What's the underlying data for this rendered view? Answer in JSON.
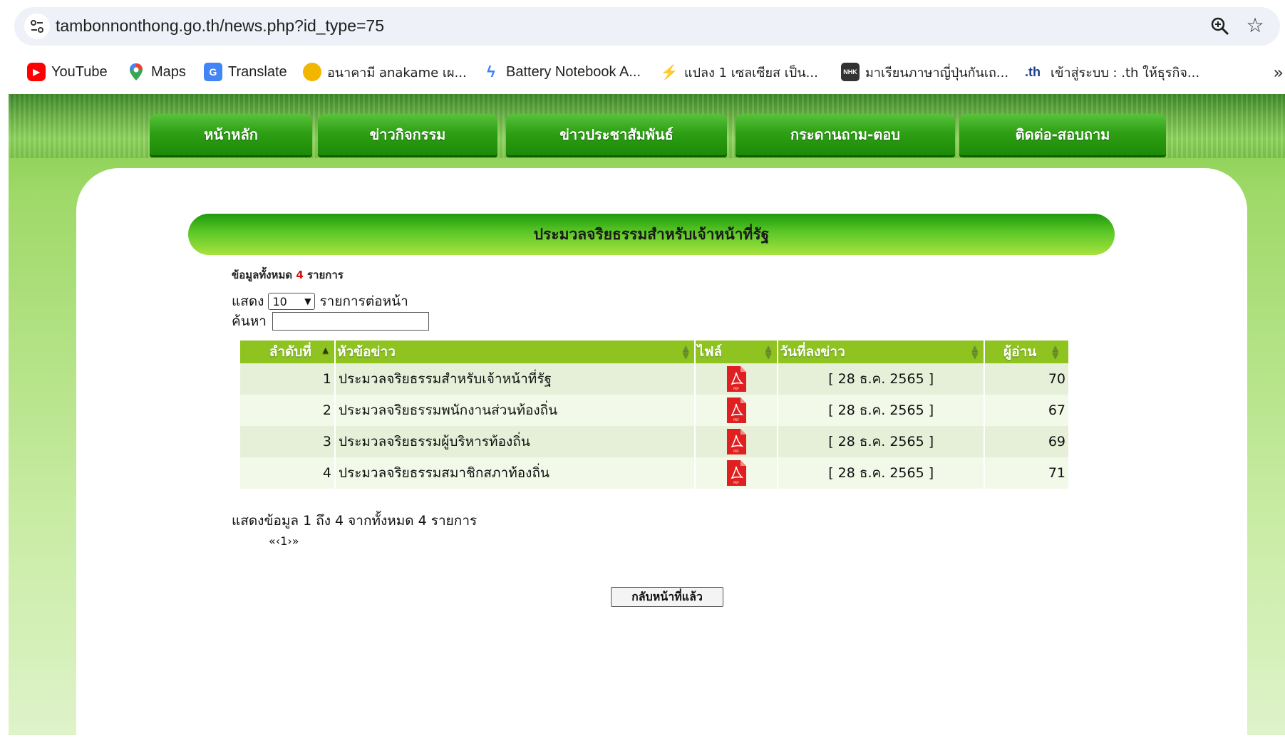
{
  "browser": {
    "url": "tambonnonthong.go.th/news.php?id_type=75"
  },
  "bookmarks": [
    {
      "label": "YouTube",
      "icon": "youtube-icon"
    },
    {
      "label": "Maps",
      "icon": "maps-icon"
    },
    {
      "label": "Translate",
      "icon": "translate-icon"
    },
    {
      "label": "อนาคามี anakame เผ...",
      "icon": "circle-icon"
    },
    {
      "label": "Battery Notebook A...",
      "icon": "bolt-icon"
    },
    {
      "label": "แปลง 1 เซลเซียส เป็น...",
      "icon": "convert-icon"
    },
    {
      "label": "มาเรียนภาษาญี่ปุ่นกันเถ...",
      "icon": "nhk-icon"
    },
    {
      "label": "เข้าสู่ระบบ : .th ให้ธุรกิจ...",
      "icon": "th-icon"
    }
  ],
  "nav": [
    "หน้าหลัก",
    "ข่าวกิจกรรม",
    "ข่าวประชาสัมพันธ์",
    "กระดานถาม-ตอบ",
    "ติดต่อ-สอบถาม"
  ],
  "page": {
    "title": "ประมวลจริยธรรมสำหรับเจ้าหน้าที่รัฐ",
    "total_prefix": "ข้อมูลทั้งหมด",
    "total_count": "4",
    "total_suffix": "รายการ",
    "show_label": "แสดง",
    "per_page_value": "10",
    "per_page_suffix": "รายการต่อหน้า",
    "search_label": "ค้นหา",
    "info_text": "แสดงข้อมูล 1 ถึง 4 จากทั้งหมด 4 รายการ",
    "pager_text": "«‹1›»",
    "back_button": "กลับหน้าที่แล้ว"
  },
  "table": {
    "headers": [
      "ลำดับที่",
      "หัวข้อข่าว",
      "ไฟล์",
      "วันที่ลงข่าว",
      "ผู้อ่าน"
    ],
    "rows": [
      {
        "no": "1",
        "title": "ประมวลจริยธรรมสำหรับเจ้าหน้าที่รัฐ",
        "date": "[ 28 ธ.ค. 2565 ]",
        "reads": "70"
      },
      {
        "no": "2",
        "title": "ประมวลจริยธรรมพนักงานส่วนท้องถิ่น",
        "date": "[ 28 ธ.ค. 2565 ]",
        "reads": "67"
      },
      {
        "no": "3",
        "title": "ประมวลจริยธรรมผู้บริหารท้องถิ่น",
        "date": "[ 28 ธ.ค. 2565 ]",
        "reads": "69"
      },
      {
        "no": "4",
        "title": "ประมวลจริยธรรมสมาชิกสภาท้องถิ่น",
        "date": "[ 28 ธ.ค. 2565 ]",
        "reads": "71"
      }
    ]
  },
  "colors": {
    "nav_green": "#2fa015",
    "header_green": "#8fc31f",
    "count_red": "#d01515"
  }
}
